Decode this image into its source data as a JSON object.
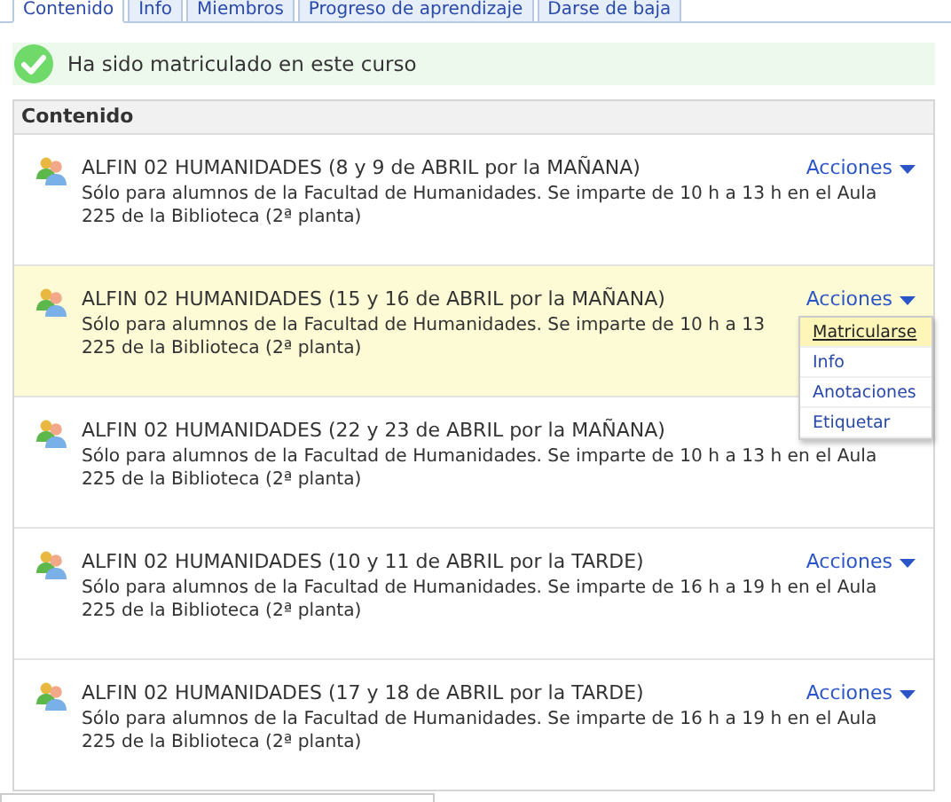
{
  "tabs": [
    {
      "label": "Contenido",
      "selected": true
    },
    {
      "label": "Info",
      "selected": false
    },
    {
      "label": "Miembros",
      "selected": false
    },
    {
      "label": "Progreso de aprendizaje",
      "selected": false
    },
    {
      "label": "Darse de baja",
      "selected": false
    }
  ],
  "message": {
    "text": "Ha sido matriculado en este curso"
  },
  "panel": {
    "title": "Contenido",
    "items": [
      {
        "title": "ALFIN 02 HUMANIDADES (8 y 9 de ABRIL por la MAÑANA)",
        "description_lines": [
          "Sólo para alumnos de la Facultad de Humanidades. Se imparte de 10 h a 13 h en el Aula",
          "225 de la Biblioteca (2ª planta)"
        ],
        "actions": "Acciones",
        "highlighted": false
      },
      {
        "title": "ALFIN 02 HUMANIDADES (15 y 16 de ABRIL por la MAÑANA)",
        "description_lines": [
          "Sólo para alumnos de la Facultad de Humanidades. Se imparte de 10 h a 13",
          "225 de la Biblioteca (2ª planta)"
        ],
        "actions": "Acciones",
        "highlighted": true,
        "menu": [
          {
            "label": "Matricularse",
            "selected": true
          },
          {
            "label": "Info",
            "selected": false
          },
          {
            "label": "Anotaciones",
            "selected": false
          },
          {
            "label": "Etiquetar",
            "selected": false
          }
        ]
      },
      {
        "title": "ALFIN 02 HUMANIDADES (22 y 23 de ABRIL por la MAÑANA)",
        "description_lines": [
          "Sólo para alumnos de la Facultad de Humanidades. Se imparte de 10 h a 13 h en el Aula",
          "225 de la Biblioteca (2ª planta)"
        ],
        "highlighted": false
      },
      {
        "title": "ALFIN 02 HUMANIDADES (10 y 11 de ABRIL por la TARDE)",
        "description_lines": [
          "Sólo para alumnos de la Facultad de Humanidades. Se imparte de 16 h a 19 h en el Aula",
          "225 de la Biblioteca (2ª planta)"
        ],
        "actions": "Acciones",
        "highlighted": false
      },
      {
        "title": "ALFIN 02 HUMANIDADES (17 y 18 de ABRIL por la TARDE)",
        "description_lines": [
          "Sólo para alumnos de la Facultad de Humanidades. Se imparte de 16 h a 19 h en el Aula",
          "225 de la Biblioteca (2ª planta)"
        ],
        "actions": "Acciones",
        "highlighted": false
      }
    ]
  }
}
